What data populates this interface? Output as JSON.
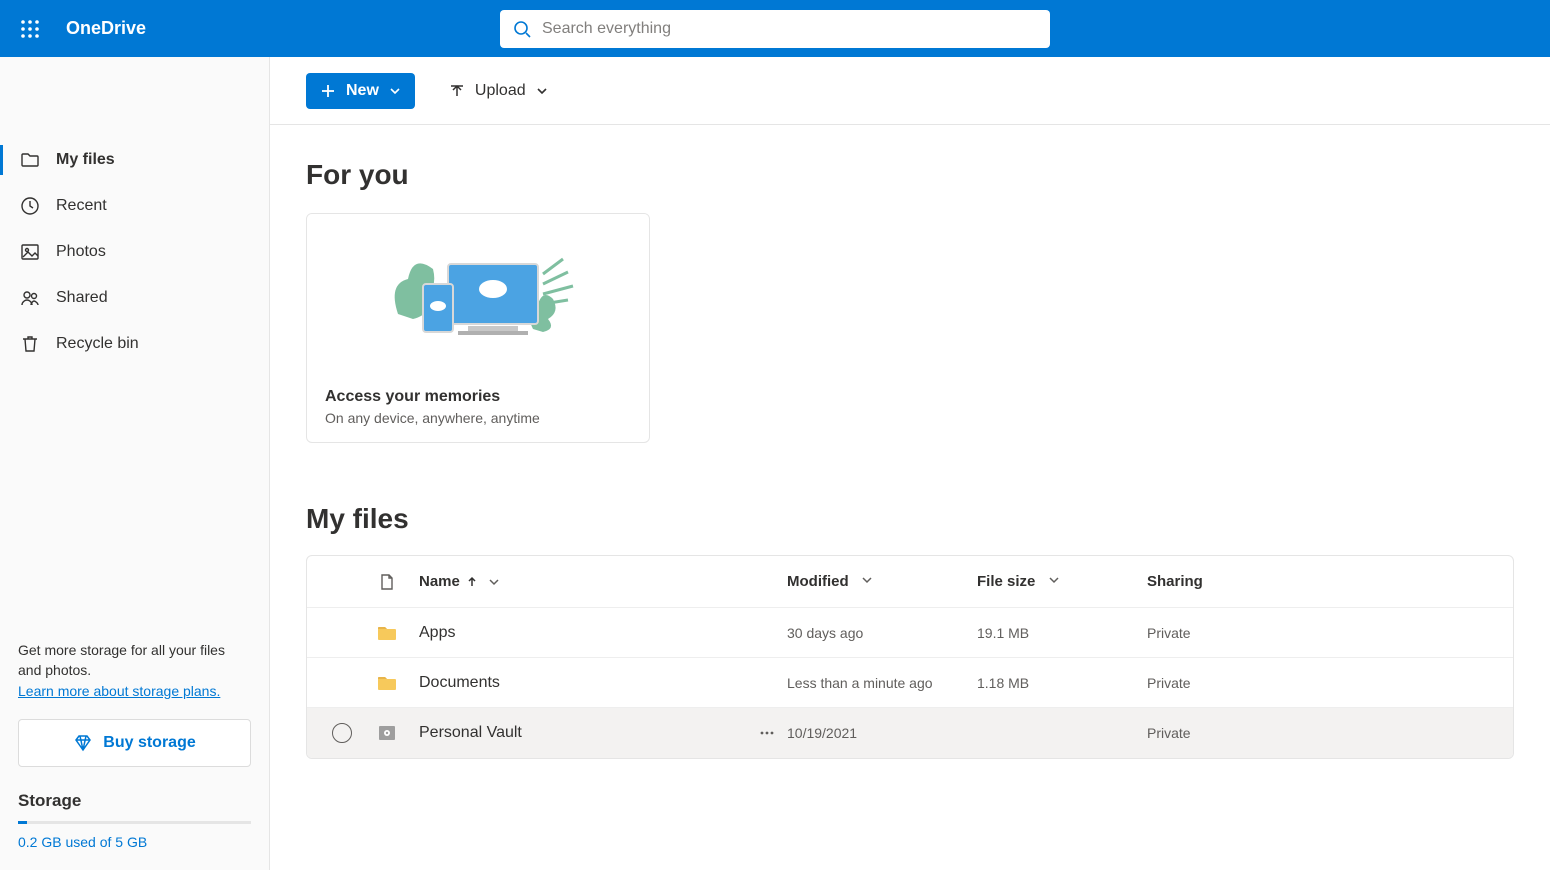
{
  "header": {
    "app_title": "OneDrive",
    "search_placeholder": "Search everything"
  },
  "sidebar": {
    "items": [
      {
        "label": "My files",
        "icon": "folder",
        "active": true
      },
      {
        "label": "Recent",
        "icon": "recent",
        "active": false
      },
      {
        "label": "Photos",
        "icon": "photo",
        "active": false
      },
      {
        "label": "Shared",
        "icon": "shared",
        "active": false
      },
      {
        "label": "Recycle bin",
        "icon": "trash",
        "active": false
      }
    ],
    "promo_text": "Get more storage for all your files and photos.",
    "promo_link": "Learn more about storage plans.",
    "buy_label": "Buy storage",
    "storage_title": "Storage",
    "storage_usage": "0.2 GB used of 5 GB"
  },
  "toolbar": {
    "new_label": "New",
    "upload_label": "Upload"
  },
  "for_you": {
    "title": "For you",
    "card_title": "Access your memories",
    "card_sub": "On any device, anywhere, anytime"
  },
  "files_section": {
    "title": "My files",
    "columns": {
      "name": "Name",
      "modified": "Modified",
      "size": "File size",
      "sharing": "Sharing"
    },
    "rows": [
      {
        "name": "Apps",
        "type": "folder",
        "modified": "30 days ago",
        "size": "19.1 MB",
        "sharing": "Private"
      },
      {
        "name": "Documents",
        "type": "folder",
        "modified": "Less than a minute ago",
        "size": "1.18 MB",
        "sharing": "Private"
      },
      {
        "name": "Personal Vault",
        "type": "vault",
        "modified": "10/19/2021",
        "size": "",
        "sharing": "Private"
      }
    ]
  }
}
